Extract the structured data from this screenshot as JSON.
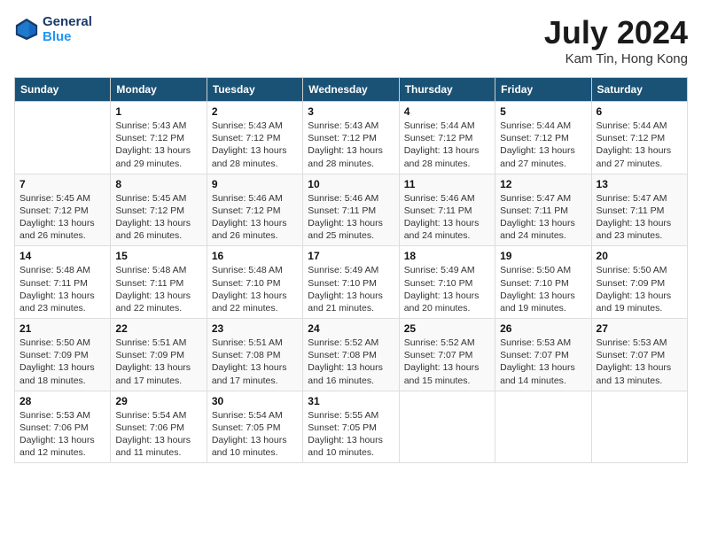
{
  "header": {
    "logo_line1": "General",
    "logo_line2": "Blue",
    "month": "July 2024",
    "location": "Kam Tin, Hong Kong"
  },
  "weekdays": [
    "Sunday",
    "Monday",
    "Tuesday",
    "Wednesday",
    "Thursday",
    "Friday",
    "Saturday"
  ],
  "weeks": [
    [
      {
        "day": "",
        "info": ""
      },
      {
        "day": "1",
        "info": "Sunrise: 5:43 AM\nSunset: 7:12 PM\nDaylight: 13 hours\nand 29 minutes."
      },
      {
        "day": "2",
        "info": "Sunrise: 5:43 AM\nSunset: 7:12 PM\nDaylight: 13 hours\nand 28 minutes."
      },
      {
        "day": "3",
        "info": "Sunrise: 5:43 AM\nSunset: 7:12 PM\nDaylight: 13 hours\nand 28 minutes."
      },
      {
        "day": "4",
        "info": "Sunrise: 5:44 AM\nSunset: 7:12 PM\nDaylight: 13 hours\nand 28 minutes."
      },
      {
        "day": "5",
        "info": "Sunrise: 5:44 AM\nSunset: 7:12 PM\nDaylight: 13 hours\nand 27 minutes."
      },
      {
        "day": "6",
        "info": "Sunrise: 5:44 AM\nSunset: 7:12 PM\nDaylight: 13 hours\nand 27 minutes."
      }
    ],
    [
      {
        "day": "7",
        "info": "Sunrise: 5:45 AM\nSunset: 7:12 PM\nDaylight: 13 hours\nand 26 minutes."
      },
      {
        "day": "8",
        "info": "Sunrise: 5:45 AM\nSunset: 7:12 PM\nDaylight: 13 hours\nand 26 minutes."
      },
      {
        "day": "9",
        "info": "Sunrise: 5:46 AM\nSunset: 7:12 PM\nDaylight: 13 hours\nand 26 minutes."
      },
      {
        "day": "10",
        "info": "Sunrise: 5:46 AM\nSunset: 7:11 PM\nDaylight: 13 hours\nand 25 minutes."
      },
      {
        "day": "11",
        "info": "Sunrise: 5:46 AM\nSunset: 7:11 PM\nDaylight: 13 hours\nand 24 minutes."
      },
      {
        "day": "12",
        "info": "Sunrise: 5:47 AM\nSunset: 7:11 PM\nDaylight: 13 hours\nand 24 minutes."
      },
      {
        "day": "13",
        "info": "Sunrise: 5:47 AM\nSunset: 7:11 PM\nDaylight: 13 hours\nand 23 minutes."
      }
    ],
    [
      {
        "day": "14",
        "info": "Sunrise: 5:48 AM\nSunset: 7:11 PM\nDaylight: 13 hours\nand 23 minutes."
      },
      {
        "day": "15",
        "info": "Sunrise: 5:48 AM\nSunset: 7:11 PM\nDaylight: 13 hours\nand 22 minutes."
      },
      {
        "day": "16",
        "info": "Sunrise: 5:48 AM\nSunset: 7:10 PM\nDaylight: 13 hours\nand 22 minutes."
      },
      {
        "day": "17",
        "info": "Sunrise: 5:49 AM\nSunset: 7:10 PM\nDaylight: 13 hours\nand 21 minutes."
      },
      {
        "day": "18",
        "info": "Sunrise: 5:49 AM\nSunset: 7:10 PM\nDaylight: 13 hours\nand 20 minutes."
      },
      {
        "day": "19",
        "info": "Sunrise: 5:50 AM\nSunset: 7:10 PM\nDaylight: 13 hours\nand 19 minutes."
      },
      {
        "day": "20",
        "info": "Sunrise: 5:50 AM\nSunset: 7:09 PM\nDaylight: 13 hours\nand 19 minutes."
      }
    ],
    [
      {
        "day": "21",
        "info": "Sunrise: 5:50 AM\nSunset: 7:09 PM\nDaylight: 13 hours\nand 18 minutes."
      },
      {
        "day": "22",
        "info": "Sunrise: 5:51 AM\nSunset: 7:09 PM\nDaylight: 13 hours\nand 17 minutes."
      },
      {
        "day": "23",
        "info": "Sunrise: 5:51 AM\nSunset: 7:08 PM\nDaylight: 13 hours\nand 17 minutes."
      },
      {
        "day": "24",
        "info": "Sunrise: 5:52 AM\nSunset: 7:08 PM\nDaylight: 13 hours\nand 16 minutes."
      },
      {
        "day": "25",
        "info": "Sunrise: 5:52 AM\nSunset: 7:07 PM\nDaylight: 13 hours\nand 15 minutes."
      },
      {
        "day": "26",
        "info": "Sunrise: 5:53 AM\nSunset: 7:07 PM\nDaylight: 13 hours\nand 14 minutes."
      },
      {
        "day": "27",
        "info": "Sunrise: 5:53 AM\nSunset: 7:07 PM\nDaylight: 13 hours\nand 13 minutes."
      }
    ],
    [
      {
        "day": "28",
        "info": "Sunrise: 5:53 AM\nSunset: 7:06 PM\nDaylight: 13 hours\nand 12 minutes."
      },
      {
        "day": "29",
        "info": "Sunrise: 5:54 AM\nSunset: 7:06 PM\nDaylight: 13 hours\nand 11 minutes."
      },
      {
        "day": "30",
        "info": "Sunrise: 5:54 AM\nSunset: 7:05 PM\nDaylight: 13 hours\nand 10 minutes."
      },
      {
        "day": "31",
        "info": "Sunrise: 5:55 AM\nSunset: 7:05 PM\nDaylight: 13 hours\nand 10 minutes."
      },
      {
        "day": "",
        "info": ""
      },
      {
        "day": "",
        "info": ""
      },
      {
        "day": "",
        "info": ""
      }
    ]
  ]
}
